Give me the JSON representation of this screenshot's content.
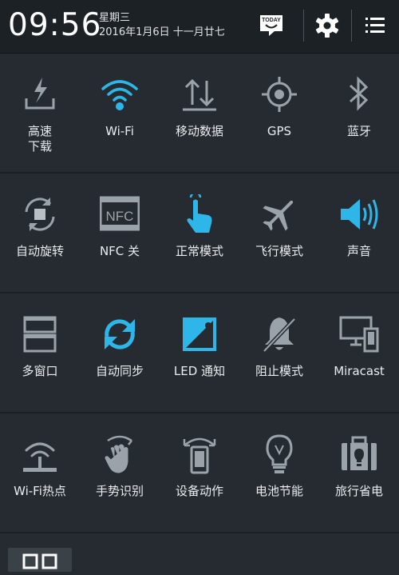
{
  "status_bar": {
    "time": "09:56",
    "weekday": "星期三",
    "date": "2016年1月6日 十一月廿七",
    "today_badge": "TODAY",
    "icons": [
      "today-icon",
      "settings-gear-icon",
      "list-menu-icon"
    ]
  },
  "colors": {
    "accent": "#2fb6e8",
    "inactive_icon": "#9aa3aa",
    "background": "#252b30"
  },
  "toggles": [
    {
      "label": "高速\n下载",
      "icon": "download-boost-icon",
      "active": false
    },
    {
      "label": "Wi-Fi",
      "icon": "wifi-icon",
      "active": true
    },
    {
      "label": "移动数据",
      "icon": "mobile-data-icon",
      "active": false
    },
    {
      "label": "GPS",
      "icon": "gps-icon",
      "active": false
    },
    {
      "label": "蓝牙",
      "icon": "bluetooth-icon",
      "active": false
    },
    {
      "label": "自动旋转",
      "icon": "auto-rotate-icon",
      "active": false
    },
    {
      "label": "NFC 关",
      "icon": "nfc-icon",
      "active": false
    },
    {
      "label": "正常模式",
      "icon": "touch-hand-icon",
      "active": true
    },
    {
      "label": "飞行模式",
      "icon": "airplane-icon",
      "active": false
    },
    {
      "label": "声音",
      "icon": "sound-icon",
      "active": true
    },
    {
      "label": "多窗口",
      "icon": "multi-window-icon",
      "active": false
    },
    {
      "label": "自动同步",
      "icon": "sync-icon",
      "active": true
    },
    {
      "label": "LED 通知",
      "icon": "led-notification-icon",
      "active": true
    },
    {
      "label": "阻止模式",
      "icon": "blocking-mode-icon",
      "active": false
    },
    {
      "label": "Miracast",
      "icon": "miracast-icon",
      "active": false
    },
    {
      "label": "Wi-Fi热点",
      "icon": "wifi-hotspot-icon",
      "active": false
    },
    {
      "label": "手势识别",
      "icon": "gesture-icon",
      "active": false
    },
    {
      "label": "设备动作",
      "icon": "device-motion-icon",
      "active": false
    },
    {
      "label": "电池节能",
      "icon": "power-saving-icon",
      "active": false
    },
    {
      "label": "旅行省电",
      "icon": "travel-power-icon",
      "active": false
    }
  ]
}
